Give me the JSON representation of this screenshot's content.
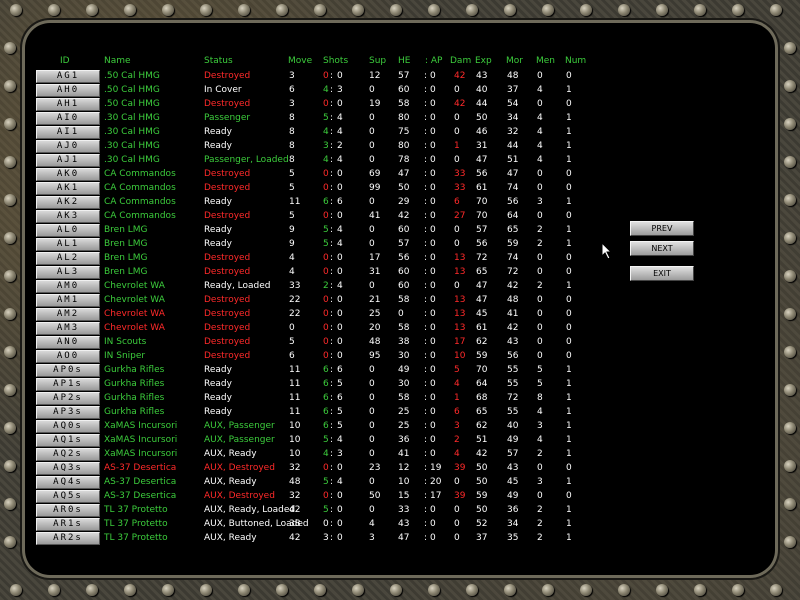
{
  "headers": {
    "id": "ID",
    "name": "Name",
    "status": "Status",
    "move": "Move",
    "shots": "Shots",
    "sup": "Sup",
    "he": "HE",
    "ap": ": AP",
    "dam": "Dam",
    "exp": "Exp",
    "mor": "Mor",
    "men": "Men",
    "num": "Num"
  },
  "buttons": {
    "prev": "PREV",
    "next": "NEXT",
    "exit": "EXIT"
  },
  "rows": [
    {
      "id": "AG1",
      "name": ".50 Cal HMG",
      "status": "Destroyed",
      "move": "3",
      "s1": "0",
      "s2": "0",
      "sup": "12",
      "he": "57",
      "ap": "0",
      "dam": "42",
      "exp": "43",
      "mor": "48",
      "men": "0",
      "num": "0",
      "nc": "g",
      "sc": "r",
      "s1c": "r",
      "dc": "r"
    },
    {
      "id": "AH0",
      "name": ".50 Cal HMG",
      "status": "In Cover",
      "move": "6",
      "s1": "4",
      "s2": "3",
      "sup": "0",
      "he": "60",
      "ap": "0",
      "dam": "0",
      "exp": "40",
      "mor": "37",
      "men": "4",
      "num": "1",
      "nc": "g",
      "sc": "w",
      "s1c": "g",
      "dc": "w"
    },
    {
      "id": "AH1",
      "name": ".50 Cal HMG",
      "status": "Destroyed",
      "move": "3",
      "s1": "0",
      "s2": "0",
      "sup": "19",
      "he": "58",
      "ap": "0",
      "dam": "42",
      "exp": "44",
      "mor": "54",
      "men": "0",
      "num": "0",
      "nc": "g",
      "sc": "r",
      "s1c": "r",
      "dc": "r"
    },
    {
      "id": "AI0",
      "name": ".30 Cal HMG",
      "status": "Passenger",
      "move": "8",
      "s1": "5",
      "s2": "4",
      "sup": "0",
      "he": "80",
      "ap": "0",
      "dam": "0",
      "exp": "50",
      "mor": "34",
      "men": "4",
      "num": "1",
      "nc": "g",
      "sc": "g",
      "s1c": "g",
      "dc": "w"
    },
    {
      "id": "AI1",
      "name": ".30 Cal HMG",
      "status": "Ready",
      "move": "8",
      "s1": "4",
      "s2": "4",
      "sup": "0",
      "he": "75",
      "ap": "0",
      "dam": "0",
      "exp": "46",
      "mor": "32",
      "men": "4",
      "num": "1",
      "nc": "g",
      "sc": "w",
      "s1c": "g",
      "dc": "w"
    },
    {
      "id": "AJ0",
      "name": ".30 Cal HMG",
      "status": "Ready",
      "move": "8",
      "s1": "3",
      "s2": "2",
      "sup": "0",
      "he": "80",
      "ap": "0",
      "dam": "1",
      "exp": "31",
      "mor": "44",
      "men": "4",
      "num": "1",
      "nc": "g",
      "sc": "w",
      "s1c": "g",
      "dc": "r"
    },
    {
      "id": "AJ1",
      "name": ".30 Cal HMG",
      "status": "Passenger,  Loaded",
      "move": "8",
      "s1": "4",
      "s2": "4",
      "sup": "0",
      "he": "78",
      "ap": "0",
      "dam": "0",
      "exp": "47",
      "mor": "51",
      "men": "4",
      "num": "1",
      "nc": "g",
      "sc": "g",
      "s1c": "g",
      "dc": "w"
    },
    {
      "id": "AK0",
      "name": "CA Commandos",
      "status": "Destroyed",
      "move": "5",
      "s1": "0",
      "s2": "0",
      "sup": "69",
      "he": "47",
      "ap": "0",
      "dam": "33",
      "exp": "56",
      "mor": "47",
      "men": "0",
      "num": "0",
      "nc": "g",
      "sc": "r",
      "s1c": "r",
      "dc": "r"
    },
    {
      "id": "AK1",
      "name": "CA Commandos",
      "status": "Destroyed",
      "move": "5",
      "s1": "0",
      "s2": "0",
      "sup": "99",
      "he": "50",
      "ap": "0",
      "dam": "33",
      "exp": "61",
      "mor": "74",
      "men": "0",
      "num": "0",
      "nc": "g",
      "sc": "r",
      "s1c": "r",
      "dc": "r"
    },
    {
      "id": "AK2",
      "name": "CA Commandos",
      "status": "Ready",
      "move": "11",
      "s1": "6",
      "s2": "6",
      "sup": "0",
      "he": "29",
      "ap": "0",
      "dam": "6",
      "exp": "70",
      "mor": "56",
      "men": "3",
      "num": "1",
      "nc": "g",
      "sc": "w",
      "s1c": "g",
      "dc": "r"
    },
    {
      "id": "AK3",
      "name": "CA Commandos",
      "status": "Destroyed",
      "move": "5",
      "s1": "0",
      "s2": "0",
      "sup": "41",
      "he": "42",
      "ap": "0",
      "dam": "27",
      "exp": "70",
      "mor": "64",
      "men": "0",
      "num": "0",
      "nc": "g",
      "sc": "r",
      "s1c": "r",
      "dc": "r"
    },
    {
      "id": "AL0",
      "name": "Bren LMG",
      "status": "Ready",
      "move": "9",
      "s1": "5",
      "s2": "4",
      "sup": "0",
      "he": "60",
      "ap": "0",
      "dam": "0",
      "exp": "57",
      "mor": "65",
      "men": "2",
      "num": "1",
      "nc": "g",
      "sc": "w",
      "s1c": "g",
      "dc": "w"
    },
    {
      "id": "AL1",
      "name": "Bren LMG",
      "status": "Ready",
      "move": "9",
      "s1": "5",
      "s2": "4",
      "sup": "0",
      "he": "57",
      "ap": "0",
      "dam": "0",
      "exp": "56",
      "mor": "59",
      "men": "2",
      "num": "1",
      "nc": "g",
      "sc": "w",
      "s1c": "g",
      "dc": "w"
    },
    {
      "id": "AL2",
      "name": "Bren LMG",
      "status": "Destroyed",
      "move": "4",
      "s1": "0",
      "s2": "0",
      "sup": "17",
      "he": "56",
      "ap": "0",
      "dam": "13",
      "exp": "72",
      "mor": "74",
      "men": "0",
      "num": "0",
      "nc": "g",
      "sc": "r",
      "s1c": "r",
      "dc": "r"
    },
    {
      "id": "AL3",
      "name": "Bren LMG",
      "status": "Destroyed",
      "move": "4",
      "s1": "0",
      "s2": "0",
      "sup": "31",
      "he": "60",
      "ap": "0",
      "dam": "13",
      "exp": "65",
      "mor": "72",
      "men": "0",
      "num": "0",
      "nc": "g",
      "sc": "r",
      "s1c": "r",
      "dc": "r"
    },
    {
      "id": "AM0",
      "name": "Chevrolet WA",
      "status": "Ready,  Loaded",
      "move": "33",
      "s1": "2",
      "s2": "4",
      "sup": "0",
      "he": "60",
      "ap": "0",
      "dam": "0",
      "exp": "47",
      "mor": "42",
      "men": "2",
      "num": "1",
      "nc": "g",
      "sc": "w",
      "s1c": "g",
      "dc": "w"
    },
    {
      "id": "AM1",
      "name": "Chevrolet WA",
      "status": "Destroyed",
      "move": "22",
      "s1": "0",
      "s2": "0",
      "sup": "21",
      "he": "58",
      "ap": "0",
      "dam": "13",
      "exp": "47",
      "mor": "48",
      "men": "0",
      "num": "0",
      "nc": "g",
      "sc": "r",
      "s1c": "r",
      "dc": "r"
    },
    {
      "id": "AM2",
      "name": "Chevrolet WA",
      "status": "Destroyed",
      "move": "22",
      "s1": "0",
      "s2": "0",
      "sup": "25",
      "he": "0",
      "ap": "0",
      "dam": "13",
      "exp": "45",
      "mor": "41",
      "men": "0",
      "num": "0",
      "nc": "r",
      "sc": "r",
      "s1c": "r",
      "dc": "r"
    },
    {
      "id": "AM3",
      "name": "Chevrolet WA",
      "status": "Destroyed",
      "move": "0",
      "s1": "0",
      "s2": "0",
      "sup": "20",
      "he": "58",
      "ap": "0",
      "dam": "13",
      "exp": "61",
      "mor": "42",
      "men": "0",
      "num": "0",
      "nc": "r",
      "sc": "r",
      "s1c": "r",
      "dc": "r"
    },
    {
      "id": "AN0",
      "name": "IN Scouts",
      "status": "Destroyed",
      "move": "5",
      "s1": "0",
      "s2": "0",
      "sup": "48",
      "he": "38",
      "ap": "0",
      "dam": "17",
      "exp": "62",
      "mor": "43",
      "men": "0",
      "num": "0",
      "nc": "g",
      "sc": "r",
      "s1c": "r",
      "dc": "r"
    },
    {
      "id": "AO0",
      "name": "IN Sniper",
      "status": "Destroyed",
      "move": "6",
      "s1": "0",
      "s2": "0",
      "sup": "95",
      "he": "30",
      "ap": "0",
      "dam": "10",
      "exp": "59",
      "mor": "56",
      "men": "0",
      "num": "0",
      "nc": "g",
      "sc": "r",
      "s1c": "r",
      "dc": "r"
    },
    {
      "id": "AP0s",
      "name": "Gurkha Rifles",
      "status": "Ready",
      "move": "11",
      "s1": "6",
      "s2": "6",
      "sup": "0",
      "he": "49",
      "ap": "0",
      "dam": "5",
      "exp": "70",
      "mor": "55",
      "men": "5",
      "num": "1",
      "nc": "g",
      "sc": "w",
      "s1c": "g",
      "dc": "r"
    },
    {
      "id": "AP1s",
      "name": "Gurkha Rifles",
      "status": "Ready",
      "move": "11",
      "s1": "6",
      "s2": "5",
      "sup": "0",
      "he": "30",
      "ap": "0",
      "dam": "4",
      "exp": "64",
      "mor": "55",
      "men": "5",
      "num": "1",
      "nc": "g",
      "sc": "w",
      "s1c": "g",
      "dc": "r"
    },
    {
      "id": "AP2s",
      "name": "Gurkha Rifles",
      "status": "Ready",
      "move": "11",
      "s1": "6",
      "s2": "6",
      "sup": "0",
      "he": "58",
      "ap": "0",
      "dam": "1",
      "exp": "68",
      "mor": "72",
      "men": "8",
      "num": "1",
      "nc": "g",
      "sc": "w",
      "s1c": "g",
      "dc": "r"
    },
    {
      "id": "AP3s",
      "name": "Gurkha Rifles",
      "status": "Ready",
      "move": "11",
      "s1": "6",
      "s2": "5",
      "sup": "0",
      "he": "25",
      "ap": "0",
      "dam": "6",
      "exp": "65",
      "mor": "55",
      "men": "4",
      "num": "1",
      "nc": "g",
      "sc": "w",
      "s1c": "g",
      "dc": "r"
    },
    {
      "id": "AQ0s",
      "name": "XaMAS Incursori",
      "status": "AUX,  Passenger",
      "move": "10",
      "s1": "6",
      "s2": "5",
      "sup": "0",
      "he": "25",
      "ap": "0",
      "dam": "3",
      "exp": "62",
      "mor": "40",
      "men": "3",
      "num": "1",
      "nc": "g",
      "sc": "g",
      "s1c": "g",
      "dc": "r"
    },
    {
      "id": "AQ1s",
      "name": "XaMAS Incursori",
      "status": "AUX,  Passenger",
      "move": "10",
      "s1": "5",
      "s2": "4",
      "sup": "0",
      "he": "36",
      "ap": "0",
      "dam": "2",
      "exp": "51",
      "mor": "49",
      "men": "4",
      "num": "1",
      "nc": "g",
      "sc": "g",
      "s1c": "g",
      "dc": "r"
    },
    {
      "id": "AQ2s",
      "name": "XaMAS Incursori",
      "status": "AUX,  Ready",
      "move": "10",
      "s1": "4",
      "s2": "3",
      "sup": "0",
      "he": "41",
      "ap": "0",
      "dam": "4",
      "exp": "42",
      "mor": "57",
      "men": "2",
      "num": "1",
      "nc": "g",
      "sc": "w",
      "s1c": "g",
      "dc": "r"
    },
    {
      "id": "AQ3s",
      "name": "AS-37 Desertica",
      "status": "AUX,  Destroyed",
      "move": "32",
      "s1": "0",
      "s2": "0",
      "sup": "23",
      "he": "12",
      "ap": "19",
      "dam": "39",
      "exp": "50",
      "mor": "43",
      "men": "0",
      "num": "0",
      "nc": "r",
      "sc": "r",
      "s1c": "r",
      "dc": "r"
    },
    {
      "id": "AQ4s",
      "name": "AS-37 Desertica",
      "status": "AUX,  Ready",
      "move": "48",
      "s1": "5",
      "s2": "4",
      "sup": "0",
      "he": "10",
      "ap": "20",
      "dam": "0",
      "exp": "50",
      "mor": "45",
      "men": "3",
      "num": "1",
      "nc": "g",
      "sc": "w",
      "s1c": "g",
      "dc": "w"
    },
    {
      "id": "AQ5s",
      "name": "AS-37 Desertica",
      "status": "AUX,  Destroyed",
      "move": "32",
      "s1": "0",
      "s2": "0",
      "sup": "50",
      "he": "15",
      "ap": "17",
      "dam": "39",
      "exp": "59",
      "mor": "49",
      "men": "0",
      "num": "0",
      "nc": "g",
      "sc": "r",
      "s1c": "r",
      "dc": "r"
    },
    {
      "id": "AR0s",
      "name": "TL 37 Protetto",
      "status": "AUX,  Ready,  Loaded",
      "move": "42",
      "s1": "5",
      "s2": "0",
      "sup": "0",
      "he": "33",
      "ap": "0",
      "dam": "0",
      "exp": "50",
      "mor": "36",
      "men": "2",
      "num": "1",
      "nc": "g",
      "sc": "w",
      "s1c": "g",
      "dc": "w"
    },
    {
      "id": "AR1s",
      "name": "TL 37 Protetto",
      "status": "AUX,  Buttoned,  Loaded",
      "move": "38",
      "s1": "0",
      "s2": "0",
      "sup": "4",
      "he": "43",
      "ap": "0",
      "dam": "0",
      "exp": "52",
      "mor": "34",
      "men": "2",
      "num": "1",
      "nc": "g",
      "sc": "w",
      "s1c": "w",
      "dc": "w"
    },
    {
      "id": "AR2s",
      "name": "TL 37 Protetto",
      "status": "AUX,  Ready",
      "move": "42",
      "s1": "3",
      "s2": "0",
      "sup": "3",
      "he": "47",
      "ap": "0",
      "dam": "0",
      "exp": "37",
      "mor": "35",
      "men": "2",
      "num": "1",
      "nc": "g",
      "sc": "w",
      "s1c": "w",
      "dc": "w"
    }
  ]
}
